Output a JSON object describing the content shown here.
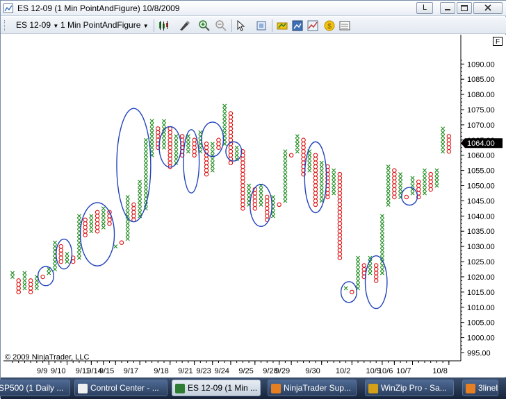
{
  "window": {
    "title": "ES 12-09 (1 Min PointAndFigure)  10/8/2009",
    "help_label": "L"
  },
  "toolbar": {
    "instrument": "ES 12-09",
    "period": "1 Min PointAndFigure"
  },
  "chart": {
    "panel_label": "F",
    "last_price_label": "1064.00",
    "copyright": "© 2009 NinjaTrader, LLC",
    "x_color": "#1a8a1a",
    "o_color": "#dd1111",
    "ellipse_color": "#2244bb"
  },
  "chart_data": {
    "type": "point-and-figure",
    "box_size": 1.25,
    "y_axis_ticks": [
      1090,
      1085,
      1080,
      1075,
      1070,
      1065,
      1060,
      1055,
      1050,
      1045,
      1040,
      1035,
      1030,
      1025,
      1020,
      1015,
      1010,
      1005,
      1000,
      995
    ],
    "y_axis_tick_labels": [
      "1090.00",
      "1085.00",
      "1080.00",
      "1075.00",
      "1070.00",
      "1065.00",
      "1060.00",
      "1055.00",
      "1050.00",
      "1045.00",
      "1040.00",
      "1035.00",
      "1030.00",
      "1025.00",
      "1020.00",
      "1015.00",
      "1010.00",
      "1005.00",
      "1000.00",
      "995.00"
    ],
    "ylim": [
      991,
      1096
    ],
    "last_price": 1064.0,
    "x_axis_labels": [
      {
        "label": "9/9",
        "column": 6
      },
      {
        "label": "9/10",
        "column": 9
      },
      {
        "label": "9/11",
        "column": 13
      },
      {
        "label": "9/14",
        "column": 15
      },
      {
        "label": "9/15",
        "column": 17
      },
      {
        "label": "9/17",
        "column": 21
      },
      {
        "label": "9/18",
        "column": 26
      },
      {
        "label": "9/21",
        "column": 30
      },
      {
        "label": "9/23",
        "column": 33
      },
      {
        "label": "9/24",
        "column": 36
      },
      {
        "label": "9/25",
        "column": 40
      },
      {
        "label": "9/28",
        "column": 44
      },
      {
        "label": "9/29",
        "column": 46
      },
      {
        "label": "9/30",
        "column": 51
      },
      {
        "label": "10/2",
        "column": 56
      },
      {
        "label": "10/5",
        "column": 61
      },
      {
        "label": "10/6",
        "column": 63
      },
      {
        "label": "10/7",
        "column": 66
      },
      {
        "label": "10/8",
        "column": 72
      }
    ],
    "columns": [
      {
        "t": "X",
        "lo": 1020,
        "hi": 1021.25
      },
      {
        "t": "O",
        "lo": 1015,
        "hi": 1018.75
      },
      {
        "t": "X",
        "lo": 1016.25,
        "hi": 1021.25
      },
      {
        "t": "O",
        "lo": 1015,
        "hi": 1018.75
      },
      {
        "t": "X",
        "lo": 1016.25,
        "hi": 1020
      },
      {
        "t": "O",
        "lo": 1020,
        "hi": 1020
      },
      {
        "t": "X",
        "lo": 1021.25,
        "hi": 1022.5
      },
      {
        "t": "X",
        "lo": 1022.5,
        "hi": 1031.25
      },
      {
        "t": "O",
        "lo": 1025,
        "hi": 1030
      },
      {
        "t": "X",
        "lo": 1025,
        "hi": 1027.5
      },
      {
        "t": "O",
        "lo": 1025,
        "hi": 1026.25
      },
      {
        "t": "X",
        "lo": 1026.25,
        "hi": 1040
      },
      {
        "t": "O",
        "lo": 1033.75,
        "hi": 1038.75
      },
      {
        "t": "X",
        "lo": 1035,
        "hi": 1040
      },
      {
        "t": "O",
        "lo": 1035,
        "hi": 1041.25
      },
      {
        "t": "X",
        "lo": 1036.25,
        "hi": 1042.5
      },
      {
        "t": "O",
        "lo": 1037.5,
        "hi": 1041.25
      },
      {
        "t": "X",
        "lo": 1030,
        "hi": 1030
      },
      {
        "t": "O",
        "lo": 1031.25,
        "hi": 1031.25
      },
      {
        "t": "X",
        "lo": 1032.5,
        "hi": 1046.25
      },
      {
        "t": "O",
        "lo": 1038.75,
        "hi": 1043.75
      },
      {
        "t": "X",
        "lo": 1040,
        "hi": 1051.25
      },
      {
        "t": "X",
        "lo": 1042.5,
        "hi": 1065
      },
      {
        "t": "X",
        "lo": 1060,
        "hi": 1071.25
      },
      {
        "t": "O",
        "lo": 1062.5,
        "hi": 1068.75
      },
      {
        "t": "X",
        "lo": 1062.5,
        "hi": 1071.25
      },
      {
        "t": "O",
        "lo": 1056.25,
        "hi": 1068.75
      },
      {
        "t": "X",
        "lo": 1057.5,
        "hi": 1066.25
      },
      {
        "t": "O",
        "lo": 1060,
        "hi": 1066.25
      },
      {
        "t": "X",
        "lo": 1061.25,
        "hi": 1066.25
      },
      {
        "t": "O",
        "lo": 1060,
        "hi": 1065
      },
      {
        "t": "X",
        "lo": 1061.25,
        "hi": 1067.5
      },
      {
        "t": "O",
        "lo": 1053.75,
        "hi": 1063.75
      },
      {
        "t": "X",
        "lo": 1055,
        "hi": 1063.75
      },
      {
        "t": "O",
        "lo": 1062.5,
        "hi": 1065
      },
      {
        "t": "X",
        "lo": 1063.75,
        "hi": 1076.25
      },
      {
        "t": "O",
        "lo": 1057.5,
        "hi": 1073.75
      },
      {
        "t": "X",
        "lo": 1058.75,
        "hi": 1062.5
      },
      {
        "t": "O",
        "lo": 1042.5,
        "hi": 1061.25
      },
      {
        "t": "X",
        "lo": 1043.75,
        "hi": 1050
      },
      {
        "t": "O",
        "lo": 1042.5,
        "hi": 1048.75
      },
      {
        "t": "X",
        "lo": 1043.75,
        "hi": 1050
      },
      {
        "t": "O",
        "lo": 1038.75,
        "hi": 1046.25
      },
      {
        "t": "X",
        "lo": 1040,
        "hi": 1046.25
      },
      {
        "t": "O",
        "lo": 1043.75,
        "hi": 1043.75
      },
      {
        "t": "X",
        "lo": 1045,
        "hi": 1061.25
      },
      {
        "t": "O",
        "lo": 1060,
        "hi": 1060
      },
      {
        "t": "X",
        "lo": 1061.25,
        "hi": 1066.25
      },
      {
        "t": "O",
        "lo": 1053.75,
        "hi": 1065
      },
      {
        "t": "X",
        "lo": 1055,
        "hi": 1061.25
      },
      {
        "t": "O",
        "lo": 1043.75,
        "hi": 1060
      },
      {
        "t": "X",
        "lo": 1045,
        "hi": 1057.5
      },
      {
        "t": "O",
        "lo": 1046.25,
        "hi": 1056.25
      },
      {
        "t": "X",
        "lo": 1047.5,
        "hi": 1055
      },
      {
        "t": "O",
        "lo": 1026.25,
        "hi": 1053.75
      },
      {
        "t": "X",
        "lo": 1016.25,
        "hi": 1016.25
      },
      {
        "t": "O",
        "lo": 1015,
        "hi": 1015
      },
      {
        "t": "X",
        "lo": 1016.25,
        "hi": 1026.25
      },
      {
        "t": "O",
        "lo": 1020,
        "hi": 1023.75
      },
      {
        "t": "X",
        "lo": 1021.25,
        "hi": 1026.25
      },
      {
        "t": "O",
        "lo": 1018.75,
        "hi": 1023.75
      },
      {
        "t": "X",
        "lo": 1021.25,
        "hi": 1040
      },
      {
        "t": "X",
        "lo": 1043.75,
        "hi": 1056.25
      },
      {
        "t": "O",
        "lo": 1046.25,
        "hi": 1055
      },
      {
        "t": "X",
        "lo": 1046.25,
        "hi": 1053.75
      },
      {
        "t": "O",
        "lo": 1046.25,
        "hi": 1046.25
      },
      {
        "t": "X",
        "lo": 1047.5,
        "hi": 1052.5
      },
      {
        "t": "O",
        "lo": 1046.25,
        "hi": 1051.25
      },
      {
        "t": "X",
        "lo": 1047.5,
        "hi": 1055
      },
      {
        "t": "O",
        "lo": 1048.75,
        "hi": 1053.75
      },
      {
        "t": "X",
        "lo": 1050,
        "hi": 1055
      },
      {
        "t": "X",
        "lo": 1061.25,
        "hi": 1068.75
      },
      {
        "t": "O",
        "lo": 1061.25,
        "hi": 1066.25
      }
    ],
    "highlight_ellipses": [
      {
        "c0": 5,
        "c1": 6,
        "lo": 1018,
        "hi": 1022.5
      },
      {
        "c0": 8,
        "c1": 9,
        "lo": 1023.5,
        "hi": 1031.5
      },
      {
        "c0": 12,
        "c1": 16,
        "lo": 1024.5,
        "hi": 1043.5
      },
      {
        "c0": 18,
        "c1": 22,
        "lo": 1039,
        "hi": 1074.5
      },
      {
        "c0": 25,
        "c1": 27,
        "lo": 1057,
        "hi": 1068.5
      },
      {
        "c0": 29,
        "c1": 30,
        "lo": 1048.5,
        "hi": 1067.5
      },
      {
        "c0": 32,
        "c1": 34,
        "lo": 1060.5,
        "hi": 1070
      },
      {
        "c0": 36,
        "c1": 37,
        "lo": 1059,
        "hi": 1063.5
      },
      {
        "c0": 40,
        "c1": 42,
        "lo": 1037.5,
        "hi": 1049.5
      },
      {
        "c0": 49,
        "c1": 51,
        "lo": 1042,
        "hi": 1063.5
      },
      {
        "c0": 55,
        "c1": 56,
        "lo": 1012.5,
        "hi": 1017.5
      },
      {
        "c0": 59,
        "c1": 61,
        "lo": 1010.5,
        "hi": 1026
      },
      {
        "c0": 65,
        "c1": 66,
        "lo": 1044.5,
        "hi": 1048.5
      }
    ]
  },
  "taskbar": {
    "items": [
      {
        "label": "SP500 (1 Daily ...",
        "icon_color": "#c0392b"
      },
      {
        "label": "Control Center - ...",
        "icon_color": "#f0f0f0"
      },
      {
        "label": "ES 12-09 (1 Min ...",
        "icon_color": "#2e7d32"
      },
      {
        "label": "NinjaTrader Sup...",
        "icon_color": "#e67e22"
      },
      {
        "label": "WinZip Pro - Sa...",
        "icon_color": "#d4a017"
      },
      {
        "label": "3lineb",
        "icon_color": "#e67e22"
      }
    ]
  }
}
